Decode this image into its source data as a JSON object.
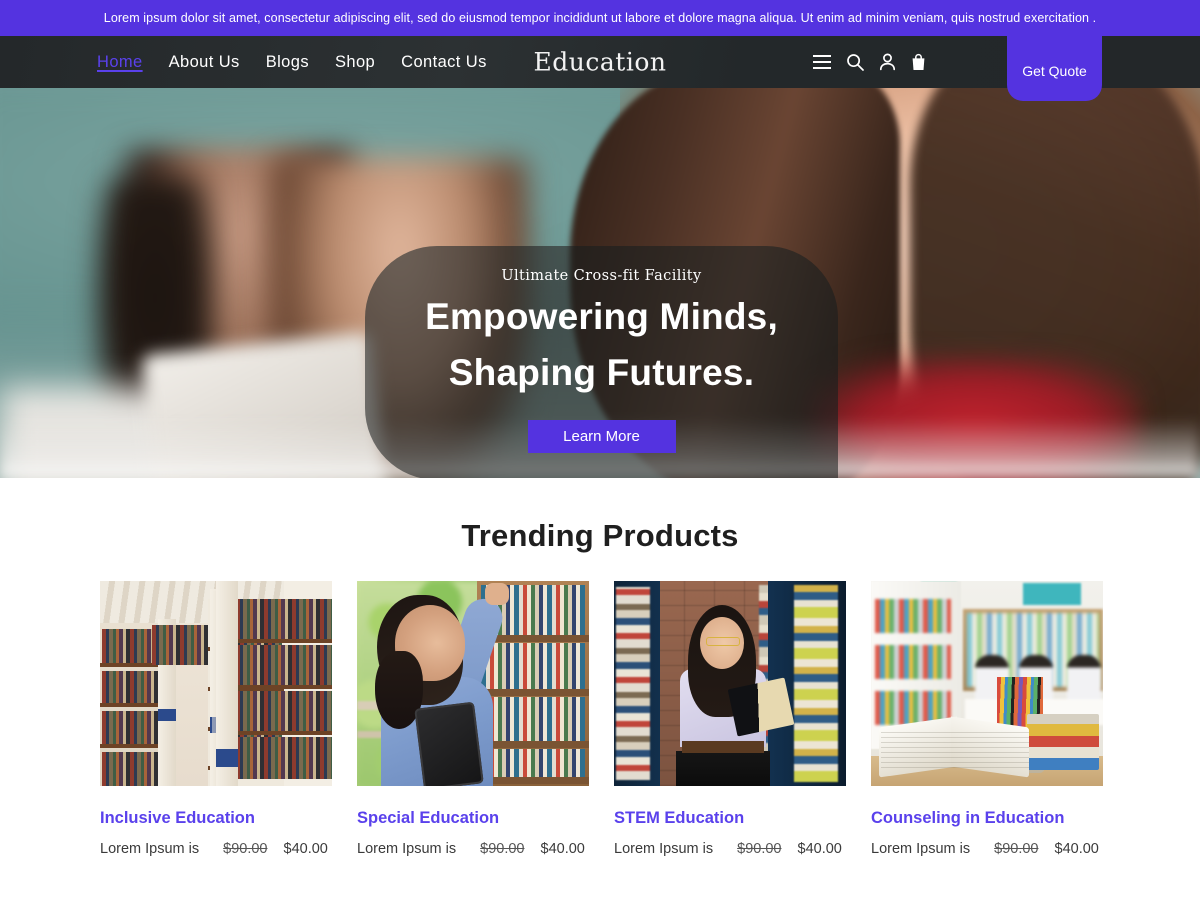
{
  "topbar": {
    "text": "Lorem ipsum dolor sit amet, consectetur adipiscing elit, sed do eiusmod tempor incididunt ut labore et dolore magna aliqua. Ut enim ad minim veniam, quis nostrud exercitation ."
  },
  "header": {
    "logo": "Education",
    "nav": [
      {
        "label": "Home",
        "active": true
      },
      {
        "label": "About Us",
        "active": false
      },
      {
        "label": "Blogs",
        "active": false
      },
      {
        "label": "Shop",
        "active": false
      },
      {
        "label": "Contact Us",
        "active": false
      }
    ],
    "icons": [
      "hamburger-menu-icon",
      "search-icon",
      "user-account-icon",
      "shopping-bag-icon"
    ],
    "quote_button": "Get Quote"
  },
  "hero": {
    "eyebrow": "Ultimate Cross-fit Facility",
    "title_line1": "Empowering Minds,",
    "title_line2": "Shaping Futures.",
    "button": "Learn More"
  },
  "products": {
    "section_title": "Trending Products",
    "items": [
      {
        "title": "Inclusive Education",
        "desc": "Lorem Ipsum is",
        "price_old": "$90.00",
        "price_new": "$40.00",
        "image": "library-bookshelves-photo"
      },
      {
        "title": "Special Education",
        "desc": "Lorem Ipsum is",
        "price_old": "$90.00",
        "price_new": "$40.00",
        "image": "student-reaching-for-book-photo"
      },
      {
        "title": "STEM Education",
        "desc": "Lorem Ipsum is",
        "price_old": "$90.00",
        "price_new": "$40.00",
        "image": "student-reading-in-library-photo"
      },
      {
        "title": "Counseling in Education",
        "desc": "Lorem Ipsum is",
        "price_old": "$90.00",
        "price_new": "$40.00",
        "image": "open-book-and-pencils-photo"
      }
    ]
  },
  "colors": {
    "accent_purple": "#5433e0",
    "link_purple": "#5a41ec",
    "header_dark": "#262a2b",
    "text_dark": "#1f1f1f"
  }
}
